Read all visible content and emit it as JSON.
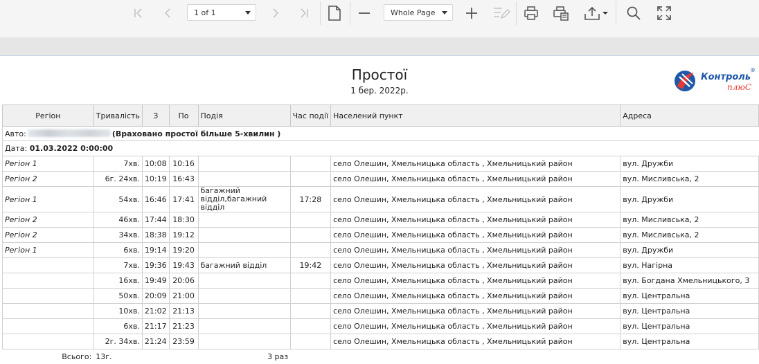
{
  "toolbar": {
    "page_select": "1 of 1",
    "zoom_select": "Whole Page"
  },
  "report": {
    "title": "Простої",
    "date": "1 бер. 2022р.",
    "logo": {
      "text_main": "Контроль",
      "text_sub": "плюС",
      "registered": "®"
    },
    "columns": [
      "Регіон",
      "Тривалість",
      "З",
      "По",
      "Подія",
      "Час події",
      "Населений пункт",
      "Адреса"
    ],
    "auto_label": "Авто:",
    "auto_note": "(Враховано простої більше 5-хвилин )",
    "date_label": "Дата:",
    "date_value": "01.03.2022 0:00:00",
    "rows": [
      {
        "region": "Регіон 1",
        "duration": "7хв.",
        "from": "10:08",
        "to": "10:16",
        "event": "",
        "event_time": "",
        "locality": "село Олешин, Хмельницька область , Хмельницький район",
        "address": "вул. Дружби"
      },
      {
        "region": "Регіон 2",
        "duration": "6г. 24хв.",
        "from": "10:19",
        "to": "16:43",
        "event": "",
        "event_time": "",
        "locality": "село Олешин, Хмельницька область , Хмельницький район",
        "address": "вул. Мисливська, 2"
      },
      {
        "region": "Регіон 1",
        "duration": "54хв.",
        "from": "16:46",
        "to": "17:41",
        "event": "багажний відділ,багажний відділ",
        "event_time": "17:28",
        "locality": "село Олешин, Хмельницька область , Хмельницький район",
        "address": "вул. Дружби"
      },
      {
        "region": "Регіон 2",
        "duration": "46хв.",
        "from": "17:44",
        "to": "18:30",
        "event": "",
        "event_time": "",
        "locality": "село Олешин, Хмельницька область , Хмельницький район",
        "address": "вул. Мисливська, 2"
      },
      {
        "region": "Регіон 2",
        "duration": "34хв.",
        "from": "18:38",
        "to": "19:12",
        "event": "",
        "event_time": "",
        "locality": "село Олешин, Хмельницька область , Хмельницький район",
        "address": "вул. Мисливська, 2"
      },
      {
        "region": "Регіон 1",
        "duration": "6хв.",
        "from": "19:14",
        "to": "19:20",
        "event": "",
        "event_time": "",
        "locality": "село Олешин, Хмельницька область , Хмельницький район",
        "address": "вул. Дружби"
      },
      {
        "region": "",
        "duration": "7хв.",
        "from": "19:36",
        "to": "19:43",
        "event": "багажний відділ",
        "event_time": "19:42",
        "locality": "село Олешин, Хмельницька область , Хмельницький район",
        "address": "вул. Нагірна"
      },
      {
        "region": "",
        "duration": "16хв.",
        "from": "19:49",
        "to": "20:06",
        "event": "",
        "event_time": "",
        "locality": "село Олешин, Хмельницька область , Хмельницький район",
        "address": "вул. Богдана Хмельницького, 3"
      },
      {
        "region": "",
        "duration": "50хв.",
        "from": "20:09",
        "to": "21:00",
        "event": "",
        "event_time": "",
        "locality": "село Олешин, Хмельницька область , Хмельницький район",
        "address": "вул. Центральна"
      },
      {
        "region": "",
        "duration": "10хв.",
        "from": "21:02",
        "to": "21:13",
        "event": "",
        "event_time": "",
        "locality": "село Олешин, Хмельницька область , Хмельницький район",
        "address": "вул. Центральна"
      },
      {
        "region": "",
        "duration": "6хв.",
        "from": "21:17",
        "to": "21:23",
        "event": "",
        "event_time": "",
        "locality": "село Олешин, Хмельницька область , Хмельницький район",
        "address": "вул. Центральна"
      },
      {
        "region": "",
        "duration": "2г. 34хв.",
        "from": "21:24",
        "to": "23:59",
        "event": "",
        "event_time": "",
        "locality": "село Олешин, Хмельницька область , Хмельницький район",
        "address": "вул. Центральна"
      }
    ],
    "total": {
      "label": "Всього:",
      "duration": "13г.",
      "count": "3 раз"
    }
  }
}
